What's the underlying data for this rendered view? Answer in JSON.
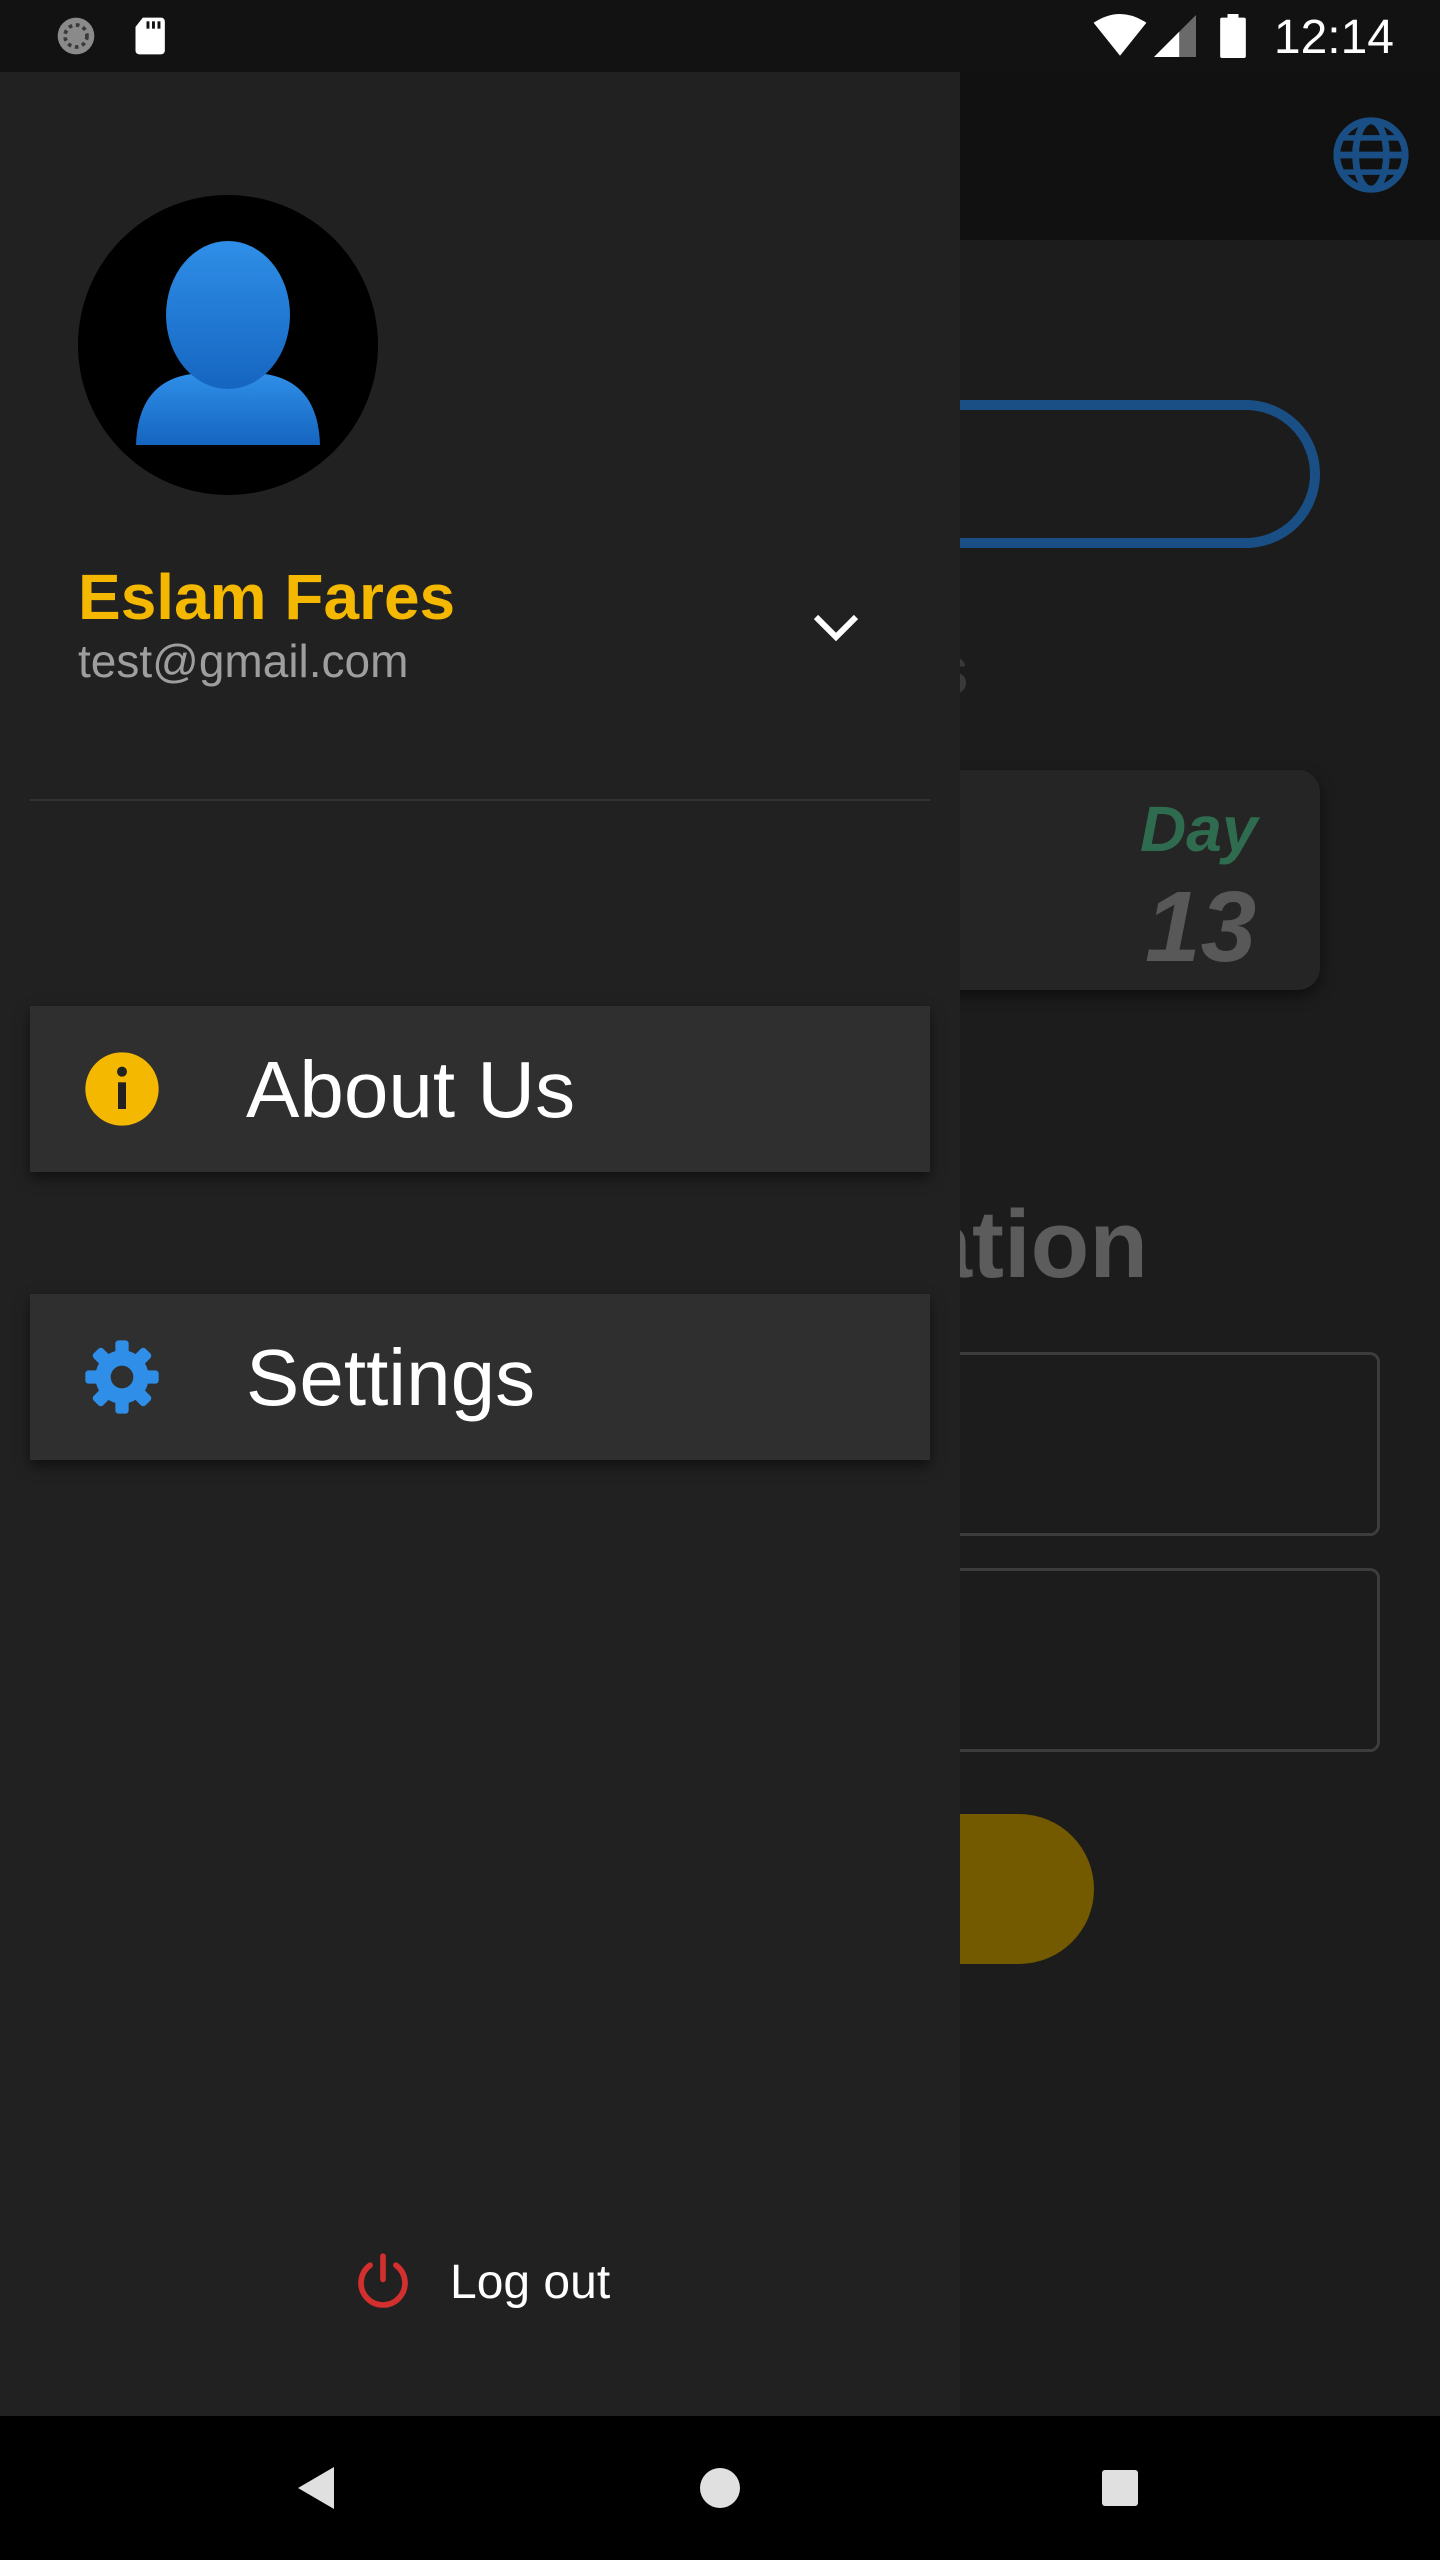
{
  "status_bar": {
    "time": "12:14",
    "icons": [
      "sync-icon",
      "sd-card-icon",
      "wifi-icon",
      "signal-icon",
      "battery-icon"
    ]
  },
  "background_app": {
    "toolbar_icon": "globe-icon",
    "partial_text": "s",
    "day_label": "Day",
    "day_number": "13",
    "heading_partial": "nation",
    "accent_blue": "#1a4f86",
    "button_color": "#735a00"
  },
  "drawer": {
    "avatar_icon": "user-silhouette-icon",
    "user": {
      "name": "Eslam Fares",
      "email": "test@gmail.com"
    },
    "account_toggle_icon": "chevron-down-icon",
    "menu": [
      {
        "label": "About Us",
        "icon": "info-icon",
        "icon_color": "#f5b800"
      },
      {
        "label": "Settings",
        "icon": "gear-icon",
        "icon_color": "#2f8fe8"
      }
    ],
    "logout": {
      "label": "Log out",
      "icon": "power-icon",
      "icon_color": "#d32f2f"
    }
  },
  "nav_bar": {
    "buttons": [
      "back-icon",
      "home-icon",
      "recents-icon"
    ]
  },
  "colors": {
    "drawer_bg": "#212121",
    "name_color": "#f5b800",
    "email_color": "#9e9e9e",
    "menu_item_bg": "#2f2f2f"
  }
}
